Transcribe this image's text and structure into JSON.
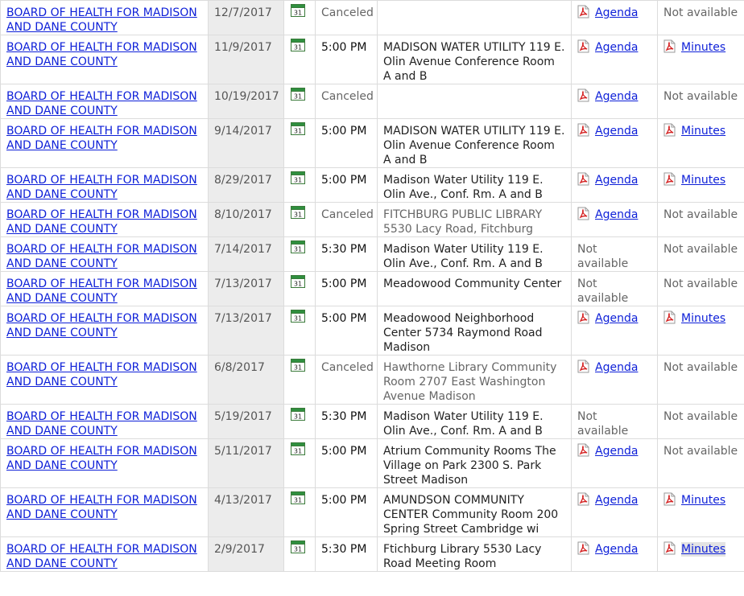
{
  "rows": [
    {
      "name": "BOARD OF HEALTH FOR MADISON AND DANE COUNTY",
      "date": "12/7/2017",
      "time": "Canceled",
      "time_canceled": true,
      "location": "",
      "agenda": "Agenda",
      "agenda_available": true,
      "minutes": "Not available",
      "minutes_available": false
    },
    {
      "name": "BOARD OF HEALTH FOR MADISON AND DANE COUNTY",
      "date": "11/9/2017",
      "time": "5:00 PM",
      "time_canceled": false,
      "location": "MADISON WATER UTILITY 119 E. Olin Avenue Conference Room A and B",
      "agenda": "Agenda",
      "agenda_available": true,
      "minutes": "Minutes",
      "minutes_available": true
    },
    {
      "name": "BOARD OF HEALTH FOR MADISON AND DANE COUNTY",
      "date": "10/19/2017",
      "time": "Canceled",
      "time_canceled": true,
      "location": "",
      "agenda": "Agenda",
      "agenda_available": true,
      "minutes": "Not available",
      "minutes_available": false
    },
    {
      "name": "BOARD OF HEALTH FOR MADISON AND DANE COUNTY",
      "date": "9/14/2017",
      "time": "5:00 PM",
      "time_canceled": false,
      "location": "MADISON WATER UTILITY 119 E. Olin Avenue Conference Room A and B",
      "agenda": "Agenda",
      "agenda_available": true,
      "minutes": "Minutes",
      "minutes_available": true
    },
    {
      "name": "BOARD OF HEALTH FOR MADISON AND DANE COUNTY",
      "date": "8/29/2017",
      "time": "5:00 PM",
      "time_canceled": false,
      "location": "Madison Water Utility 119 E. Olin Ave., Conf. Rm. A and B",
      "agenda": "Agenda",
      "agenda_available": true,
      "minutes": "Minutes",
      "minutes_available": true
    },
    {
      "name": "BOARD OF HEALTH FOR MADISON AND DANE COUNTY",
      "date": "8/10/2017",
      "time": "Canceled",
      "time_canceled": true,
      "location": "FITCHBURG PUBLIC LIBRARY 5530 Lacy Road, Fitchburg",
      "agenda": "Agenda",
      "agenda_available": true,
      "minutes": "Not available",
      "minutes_available": false
    },
    {
      "name": "BOARD OF HEALTH FOR MADISON AND DANE COUNTY",
      "date": "7/14/2017",
      "time": "5:30 PM",
      "time_canceled": false,
      "location": "Madison Water Utility 119 E. Olin Ave., Conf. Rm. A and B",
      "agenda": "Not available",
      "agenda_available": false,
      "minutes": "Not available",
      "minutes_available": false
    },
    {
      "name": "BOARD OF HEALTH FOR MADISON AND DANE COUNTY",
      "date": "7/13/2017",
      "time": "5:00 PM",
      "time_canceled": false,
      "location": "Meadowood Community Center",
      "agenda": "Not available",
      "agenda_available": false,
      "minutes": "Not available",
      "minutes_available": false
    },
    {
      "name": "BOARD OF HEALTH FOR MADISON AND DANE COUNTY",
      "date": "7/13/2017",
      "time": "5:00 PM",
      "time_canceled": false,
      "location": "Meadowood Neighborhood Center 5734 Raymond Road Madison",
      "agenda": "Agenda",
      "agenda_available": true,
      "minutes": "Minutes",
      "minutes_available": true
    },
    {
      "name": "BOARD OF HEALTH FOR MADISON AND DANE COUNTY",
      "date": "6/8/2017",
      "time": "Canceled",
      "time_canceled": true,
      "location": "Hawthorne Library Community Room 2707 East Washington Avenue Madison",
      "agenda": "Agenda",
      "agenda_available": true,
      "minutes": "Not available",
      "minutes_available": false
    },
    {
      "name": "BOARD OF HEALTH FOR MADISON AND DANE COUNTY",
      "date": "5/19/2017",
      "time": "5:30 PM",
      "time_canceled": false,
      "location": "Madison Water Utility 119 E. Olin Ave., Conf. Rm. A and B",
      "agenda": "Not available",
      "agenda_available": false,
      "minutes": "Not available",
      "minutes_available": false
    },
    {
      "name": "BOARD OF HEALTH FOR MADISON AND DANE COUNTY",
      "date": "5/11/2017",
      "time": "5:00 PM",
      "time_canceled": false,
      "location": "Atrium Community Rooms The Village on Park 2300 S. Park Street Madison",
      "agenda": "Agenda",
      "agenda_available": true,
      "minutes": "Not available",
      "minutes_available": false
    },
    {
      "name": "BOARD OF HEALTH FOR MADISON AND DANE COUNTY",
      "date": "4/13/2017",
      "time": "5:00 PM",
      "time_canceled": false,
      "location": "AMUNDSON COMMUNITY CENTER Community Room 200 Spring Street Cambridge wi",
      "agenda": "Agenda",
      "agenda_available": true,
      "minutes": "Minutes",
      "minutes_available": true
    },
    {
      "name": "BOARD OF HEALTH FOR MADISON AND DANE COUNTY",
      "date": "2/9/2017",
      "time": "5:30 PM",
      "time_canceled": false,
      "location": "Ftichburg Library 5530 Lacy Road Meeting Room",
      "agenda": "Agenda",
      "agenda_available": true,
      "minutes": "Minutes",
      "minutes_available": true,
      "minutes_highlighted": true
    }
  ],
  "icons": {
    "calendar": "calendar-icon",
    "pdf": "pdf-icon"
  },
  "colors": {
    "link": "#0d1fd8",
    "date_bg": "#ececec",
    "border": "#dcdcdc",
    "muted": "#666666"
  }
}
